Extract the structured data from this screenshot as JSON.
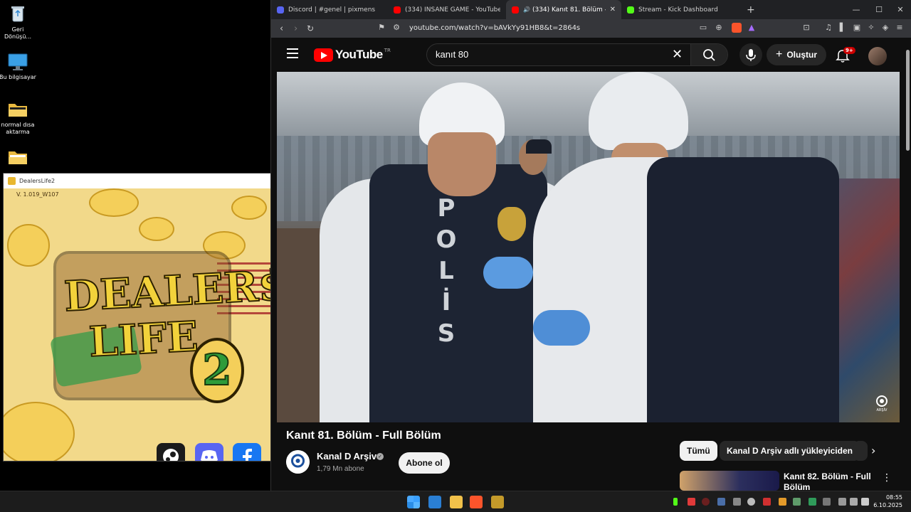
{
  "desktop": {
    "icons": [
      {
        "label": "Geri\nDönüşü..."
      },
      {
        "label": "Bu bilgisayar"
      },
      {
        "label": "normal dısa\naktarma"
      },
      {
        "label": ""
      }
    ]
  },
  "game_window": {
    "title": "DealersLife2",
    "version": "V. 1.019_W107",
    "logo_line1": "DEALER$",
    "logo_line2": "LIFE",
    "logo_number": "2"
  },
  "browser": {
    "tabs": [
      {
        "label": "Discord | #genel | pixmens",
        "color": "#5865f2",
        "active": false
      },
      {
        "label": "(334) INSANE GAME - YouTube",
        "color": "#ff0000",
        "active": false
      },
      {
        "label": "(334) Kanıt 81. Bölüm - Full B...",
        "color": "#ff0000",
        "active": true
      },
      {
        "label": "Stream - Kick Dashboard",
        "color": "#53fc18",
        "active": false
      }
    ],
    "new_tab": "+",
    "url": "youtube.com/watch?v=bAVkYy91HB8&t=2864s"
  },
  "youtube": {
    "logo": "YouTube",
    "country": "TR",
    "search_value": "kanıt 80",
    "create_label": "Oluştur",
    "notification_badge": "9+",
    "video_title": "Kanıt 81. Bölüm - Full Bölüm",
    "channel_name": "Kanal D Arşiv",
    "subscribers": "1,79 Mn abone",
    "subscribe_label": "Abone ol",
    "chips": [
      "Tümü",
      "Kanal D Arşiv adlı yükleyiciden"
    ],
    "related_title": "Kanıt 82. Bölüm - Full Bölüm",
    "video_overlay_text": [
      "P",
      "O",
      "L",
      "İ",
      "S"
    ],
    "watermark": "ARŞİV"
  },
  "taskbar": {
    "time": "08:55",
    "date": "6.10.2025"
  }
}
